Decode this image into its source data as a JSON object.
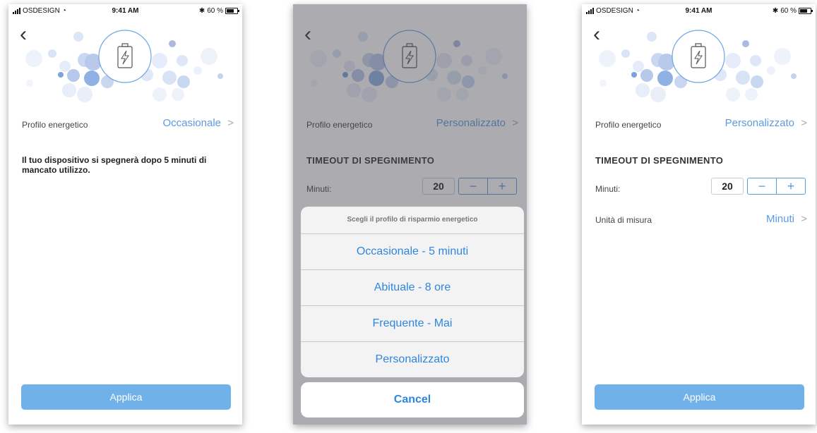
{
  "colors": {
    "accent": "#5b9be0",
    "apply_button": "#70b1ea",
    "sheet_option": "#2f86df"
  },
  "status": {
    "carrier": "OSDESIGN",
    "time": "9:41 AM",
    "battery": "60 %"
  },
  "screen1": {
    "icons": {
      "back": "chevron-left-icon",
      "battery": "battery-charging-icon"
    },
    "profile_label": "Profilo energetico",
    "profile_value": "Occasionale",
    "description": "Il tuo dispositivo si spegnerà dopo 5 minuti di mancato utilizzo.",
    "apply_label": "Applica"
  },
  "screen2": {
    "profile_label": "Profilo energetico",
    "profile_value": "Personalizzato",
    "section_title": "TIMEOUT DI SPEGNIMENTO",
    "minutes_label": "Minuti:",
    "minutes_value": "20",
    "sheet": {
      "title": "Scegli il profilo di risparmio energetico",
      "options": [
        "Occasionale - 5 minuti",
        "Abituale - 8 ore",
        "Frequente - Mai",
        "Personalizzato"
      ],
      "cancel_label": "Cancel"
    }
  },
  "screen3": {
    "profile_label": "Profilo energetico",
    "profile_value": "Personalizzato",
    "section_title": "TIMEOUT DI SPEGNIMENTO",
    "minutes_label": "Minuti:",
    "minutes_value": "20",
    "unit_label": "Unità di misura",
    "unit_value": "Minuti",
    "apply_label": "Applica"
  },
  "stepper": {
    "minus": "−",
    "plus": "+"
  },
  "chevron": ">"
}
